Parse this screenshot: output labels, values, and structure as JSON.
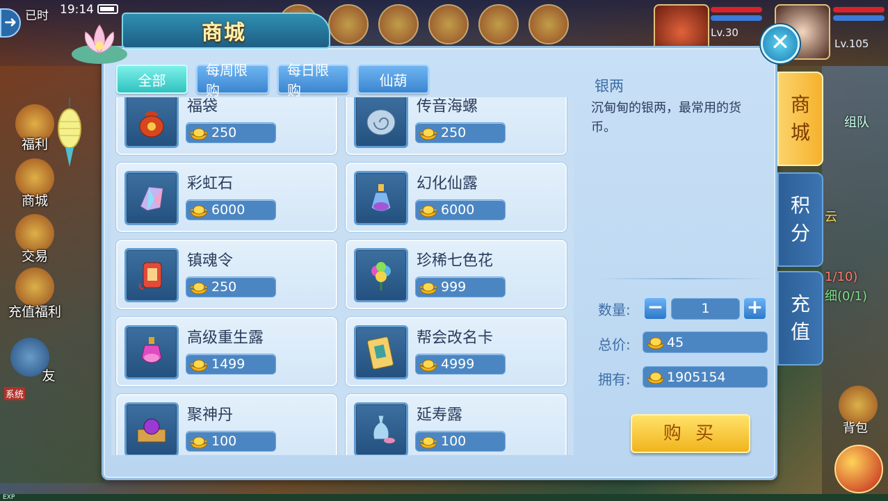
{
  "status_bar": {
    "time": "19:14",
    "time_label": "已时"
  },
  "players": [
    {
      "level": "Lv.30"
    },
    {
      "level": "Lv.105"
    }
  ],
  "left_hud": [
    "福利",
    "商城",
    "交易",
    "充值福利",
    "友"
  ],
  "right_hud": {
    "team": "组队",
    "quest_a": "云",
    "quest_b": "1/10)",
    "quest_c": "细(0/1)",
    "bag": "背包"
  },
  "bottom_hud": {
    "exp": "EXP",
    "system": "系统"
  },
  "shop": {
    "title": "商城",
    "tabs": [
      "全部",
      "每周限购",
      "每日限购",
      "仙葫"
    ],
    "active_tab": 0,
    "items": [
      {
        "name": "福袋",
        "price": "250",
        "icon": "fortune-bag-icon"
      },
      {
        "name": "传音海螺",
        "price": "250",
        "icon": "conch-shell-icon"
      },
      {
        "name": "彩虹石",
        "price": "6000",
        "icon": "rainbow-stone-icon"
      },
      {
        "name": "幻化仙露",
        "price": "6000",
        "icon": "potion-bottle-icon"
      },
      {
        "name": "镇魂令",
        "price": "250",
        "icon": "soul-token-icon"
      },
      {
        "name": "珍稀七色花",
        "price": "999",
        "icon": "seven-color-flower-icon"
      },
      {
        "name": "高级重生露",
        "price": "1499",
        "icon": "rebirth-potion-icon"
      },
      {
        "name": "帮会改名卡",
        "price": "4999",
        "icon": "guild-rename-card-icon"
      },
      {
        "name": "聚神丹",
        "price": "100",
        "icon": "spirit-pill-box-icon"
      },
      {
        "name": "延寿露",
        "price": "100",
        "icon": "longevity-vase-icon"
      }
    ],
    "detail": {
      "name": "银两",
      "description": "沉甸甸的银两，最常用的货币。",
      "quantity_label": "数量:",
      "quantity": "1",
      "total_label": "总价:",
      "total": "45",
      "owned_label": "拥有:",
      "owned": "1905154",
      "buy_label": "购 买"
    },
    "side_tabs": [
      {
        "label_top": "商",
        "label_bottom": "城"
      },
      {
        "label_top": "积",
        "label_bottom": "分"
      },
      {
        "label_top": "充",
        "label_bottom": "值"
      }
    ],
    "active_side_tab": 0
  },
  "colors": {
    "panel_bg": "#c8e0f6",
    "tab_active": "#30c2c0",
    "price_box": "#4c86c2",
    "buy_button": "#f0b41d",
    "side_tab_active": "#f6b12d"
  }
}
